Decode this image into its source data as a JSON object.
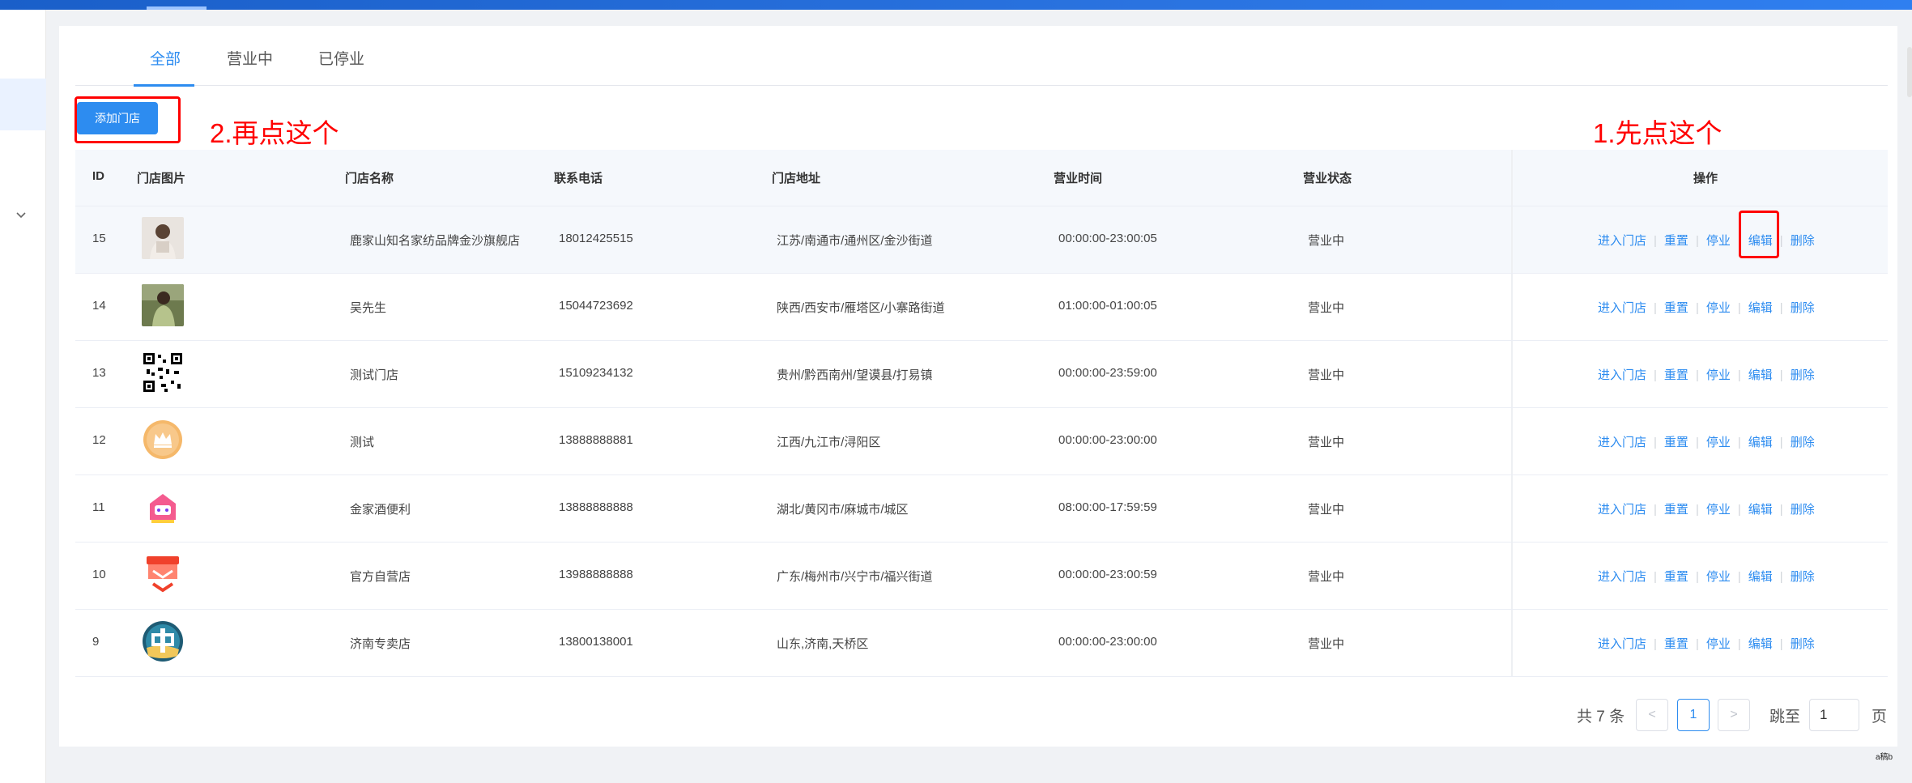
{
  "tabs": [
    {
      "label": "全部",
      "active": true
    },
    {
      "label": "营业中",
      "active": false
    },
    {
      "label": "已停业",
      "active": false
    }
  ],
  "toolbar": {
    "add_label": "添加门店"
  },
  "annotations": {
    "click_first": "1.先点这个",
    "click_second": "2.再点这个"
  },
  "table": {
    "columns": [
      "ID",
      "门店图片",
      "门店名称",
      "联系电话",
      "门店地址",
      "营业时间",
      "营业状态",
      "操作"
    ],
    "actions": [
      "进入门店",
      "重置",
      "停业",
      "编辑",
      "删除"
    ],
    "rows": [
      {
        "id": "15",
        "image_icon": "woman-photo-icon",
        "name": "鹿家山知名家纺品牌金沙旗舰店",
        "phone": "18012425515",
        "address": "江苏/南通市/通州区/金沙街道",
        "hours": "00:00:00-23:00:05",
        "status": "营业中"
      },
      {
        "id": "14",
        "image_icon": "girl-photo-icon",
        "name": "吴先生",
        "phone": "15044723692",
        "address": "陕西/西安市/雁塔区/小寨路街道",
        "hours": "01:00:00-01:00:05",
        "status": "营业中"
      },
      {
        "id": "13",
        "image_icon": "qr-code-icon",
        "name": "测试门店",
        "phone": "15109234132",
        "address": "贵州/黔西南州/望谟县/打易镇",
        "hours": "00:00:00-23:59:00",
        "status": "营业中"
      },
      {
        "id": "12",
        "image_icon": "crown-icon",
        "name": "测试",
        "phone": "13888888881",
        "address": "江西/九江市/浔阳区",
        "hours": "00:00:00-23:00:00",
        "status": "营业中"
      },
      {
        "id": "11",
        "image_icon": "shop-logo-icon",
        "name": "金家酒便利",
        "phone": "13888888888",
        "address": "湖北/黄冈市/麻城市/城区",
        "hours": "08:00:00-17:59:59",
        "status": "营业中"
      },
      {
        "id": "10",
        "image_icon": "store-logo-icon",
        "name": "官方自营店",
        "phone": "13988888888",
        "address": "广东/梅州市/兴宁市/福兴街道",
        "hours": "00:00:00-23:00:59",
        "status": "营业中"
      },
      {
        "id": "9",
        "image_icon": "zhong-logo-icon",
        "name": "济南专卖店",
        "phone": "13800138001",
        "address": "山东,济南,天桥区",
        "hours": "00:00:00-23:00:00",
        "status": "营业中"
      }
    ]
  },
  "pagination": {
    "total_text": "共 7 条",
    "prev": "<",
    "current": "1",
    "next": ">",
    "jump_label": "跳至",
    "jump_value": "1",
    "page_suffix": "页"
  },
  "footer": {
    "corner_mark": "a稿b"
  },
  "colors": {
    "accent": "#2d8cf0",
    "annotation": "#ff0000",
    "topbar": "#1a5fc9"
  }
}
